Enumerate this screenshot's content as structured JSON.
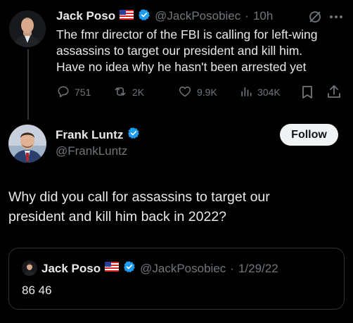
{
  "parent_tweet": {
    "display_name": "Jack Poso",
    "handle": "@JackPosobiec",
    "separator": "·",
    "time": "10h",
    "text_lines": [
      "The fmr director of the FBI is calling for left-wing",
      "assassins to target our president and kill him.",
      "Have no idea why he hasn't been arrested yet"
    ],
    "actions": {
      "replies": "751",
      "reposts": "2K",
      "likes": "9.9K",
      "views": "304K"
    },
    "icons": {
      "grok": "slashed-circle-icon",
      "more": "more-icon",
      "reply": "reply-icon",
      "repost": "repost-icon",
      "like": "heart-icon",
      "views": "views-icon",
      "bookmark": "bookmark-icon",
      "share": "share-icon"
    }
  },
  "main_tweet": {
    "display_name": "Frank Luntz",
    "handle": "@FrankLuntz",
    "follow_label": "Follow",
    "text_lines": [
      "Why did you call for assassins to target our",
      "president and kill him back in 2022?"
    ]
  },
  "quoted_tweet": {
    "display_name": "Jack Poso",
    "handle": "@JackPosobiec",
    "separator": "·",
    "date": "1/29/22",
    "text": "86 46"
  },
  "colors": {
    "background": "#000000",
    "text": "#e7e9ea",
    "muted": "#71767b",
    "verified": "#1d9bf0",
    "follow_bg": "#eff3f4",
    "border": "#2f3336"
  }
}
